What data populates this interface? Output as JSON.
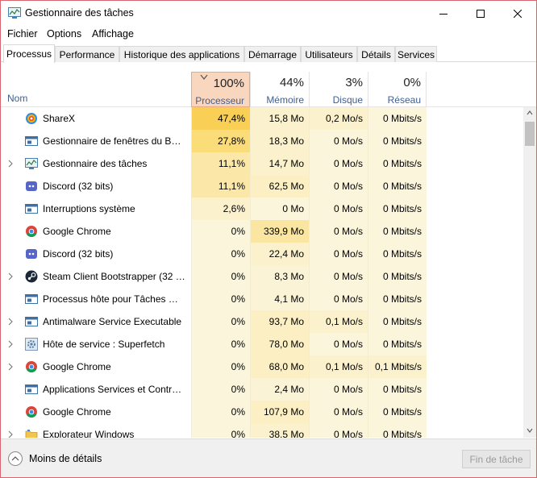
{
  "window": {
    "title": "Gestionnaire des tâches",
    "icon": "task-manager-icon"
  },
  "menu": [
    "Fichier",
    "Options",
    "Affichage"
  ],
  "tabs": [
    "Processus",
    "Performance",
    "Historique des applications",
    "Démarrage",
    "Utilisateurs",
    "Détails",
    "Services"
  ],
  "active_tab": "Processus",
  "columns": {
    "name": "Nom",
    "cpu": {
      "pct": "100%",
      "label": "Processeur"
    },
    "memory": {
      "pct": "44%",
      "label": "Mémoire"
    },
    "disk": {
      "pct": "3%",
      "label": "Disque"
    },
    "network": {
      "pct": "0%",
      "label": "Réseau"
    }
  },
  "processes": [
    {
      "name": "ShareX",
      "icon": "sharex-icon",
      "expandable": false,
      "cpu": "47,4%",
      "memory": "15,8 Mo",
      "disk": "0,2 Mo/s",
      "network": "0 Mbits/s",
      "cpu_heat": "#f9cf55",
      "mem_heat": "#fbf1cc",
      "disk_heat": "#fbf1cc",
      "net_heat": "#fbf5dc"
    },
    {
      "name": "Gestionnaire de fenêtres du Bur...",
      "icon": "window-app-icon",
      "expandable": false,
      "cpu": "27,8%",
      "memory": "18,3 Mo",
      "disk": "0 Mo/s",
      "network": "0 Mbits/s",
      "cpu_heat": "#fadc79",
      "mem_heat": "#fbf1cc",
      "disk_heat": "#fbf5dc",
      "net_heat": "#fbf5dc"
    },
    {
      "name": "Gestionnaire des tâches",
      "icon": "task-manager-icon",
      "expandable": true,
      "cpu": "11,1%",
      "memory": "14,7 Mo",
      "disk": "0 Mo/s",
      "network": "0 Mbits/s",
      "cpu_heat": "#fbe8a8",
      "mem_heat": "#fbf1cc",
      "disk_heat": "#fbf5dc",
      "net_heat": "#fbf5dc"
    },
    {
      "name": "Discord (32 bits)",
      "icon": "discord-icon",
      "expandable": false,
      "cpu": "11,1%",
      "memory": "62,5 Mo",
      "disk": "0 Mo/s",
      "network": "0 Mbits/s",
      "cpu_heat": "#fbe8a8",
      "mem_heat": "#fbefc3",
      "disk_heat": "#fbf5dc",
      "net_heat": "#fbf5dc"
    },
    {
      "name": "Interruptions système",
      "icon": "window-app-icon",
      "expandable": false,
      "cpu": "2,6%",
      "memory": "0 Mo",
      "disk": "0 Mo/s",
      "network": "0 Mbits/s",
      "cpu_heat": "#fbf1cc",
      "mem_heat": "#fbf5dc",
      "disk_heat": "#fbf5dc",
      "net_heat": "#fbf5dc"
    },
    {
      "name": "Google Chrome",
      "icon": "chrome-icon",
      "expandable": false,
      "cpu": "0%",
      "memory": "339,9 Mo",
      "disk": "0 Mo/s",
      "network": "0 Mbits/s",
      "cpu_heat": "#fbf5dc",
      "mem_heat": "#fae6a0",
      "disk_heat": "#fbf5dc",
      "net_heat": "#fbf5dc"
    },
    {
      "name": "Discord (32 bits)",
      "icon": "discord-icon",
      "expandable": false,
      "cpu": "0%",
      "memory": "22,4 Mo",
      "disk": "0 Mo/s",
      "network": "0 Mbits/s",
      "cpu_heat": "#fbf5dc",
      "mem_heat": "#fbf1cc",
      "disk_heat": "#fbf5dc",
      "net_heat": "#fbf5dc"
    },
    {
      "name": "Steam Client Bootstrapper (32 b...",
      "icon": "steam-icon",
      "expandable": true,
      "cpu": "0%",
      "memory": "8,3 Mo",
      "disk": "0 Mo/s",
      "network": "0 Mbits/s",
      "cpu_heat": "#fbf5dc",
      "mem_heat": "#fbf3d5",
      "disk_heat": "#fbf5dc",
      "net_heat": "#fbf5dc"
    },
    {
      "name": "Processus hôte pour Tâches Wi...",
      "icon": "window-app-icon",
      "expandable": false,
      "cpu": "0%",
      "memory": "4,1 Mo",
      "disk": "0 Mo/s",
      "network": "0 Mbits/s",
      "cpu_heat": "#fbf5dc",
      "mem_heat": "#fbf3d5",
      "disk_heat": "#fbf5dc",
      "net_heat": "#fbf5dc"
    },
    {
      "name": "Antimalware Service Executable",
      "icon": "window-app-icon",
      "expandable": true,
      "cpu": "0%",
      "memory": "93,7 Mo",
      "disk": "0,1 Mo/s",
      "network": "0 Mbits/s",
      "cpu_heat": "#fbf5dc",
      "mem_heat": "#fbefc3",
      "disk_heat": "#fbf1cc",
      "net_heat": "#fbf5dc"
    },
    {
      "name": "Hôte de service : Superfetch",
      "icon": "gear-icon",
      "expandable": true,
      "cpu": "0%",
      "memory": "78,0 Mo",
      "disk": "0 Mo/s",
      "network": "0 Mbits/s",
      "cpu_heat": "#fbf5dc",
      "mem_heat": "#fbefc3",
      "disk_heat": "#fbf5dc",
      "net_heat": "#fbf5dc"
    },
    {
      "name": "Google Chrome",
      "icon": "chrome-icon",
      "expandable": true,
      "cpu": "0%",
      "memory": "68,0 Mo",
      "disk": "0,1 Mo/s",
      "network": "0,1 Mbits/s",
      "cpu_heat": "#fbf5dc",
      "mem_heat": "#fbefc3",
      "disk_heat": "#fbf1cc",
      "net_heat": "#fbf1cc"
    },
    {
      "name": "Applications Services et Contrôl...",
      "icon": "window-app-icon",
      "expandable": false,
      "cpu": "0%",
      "memory": "2,4 Mo",
      "disk": "0 Mo/s",
      "network": "0 Mbits/s",
      "cpu_heat": "#fbf5dc",
      "mem_heat": "#fbf3d5",
      "disk_heat": "#fbf5dc",
      "net_heat": "#fbf5dc"
    },
    {
      "name": "Google Chrome",
      "icon": "chrome-icon",
      "expandable": false,
      "cpu": "0%",
      "memory": "107,9 Mo",
      "disk": "0 Mo/s",
      "network": "0 Mbits/s",
      "cpu_heat": "#fbf5dc",
      "mem_heat": "#fbefc3",
      "disk_heat": "#fbf5dc",
      "net_heat": "#fbf5dc"
    },
    {
      "name": "Explorateur Windows",
      "icon": "folder-icon",
      "expandable": true,
      "cpu": "0%",
      "memory": "38,5 Mo",
      "disk": "0 Mo/s",
      "network": "0 Mbits/s",
      "cpu_heat": "#fbf5dc",
      "mem_heat": "#fbf1cc",
      "disk_heat": "#fbf5dc",
      "net_heat": "#fbf5dc"
    }
  ],
  "footer": {
    "less_details": "Moins de détails",
    "end_task": "Fin de tâche"
  },
  "colors": {
    "sorted_header": "#f9d7bf",
    "header_label": "#3f5f8f",
    "window_border": "#d8646e"
  }
}
